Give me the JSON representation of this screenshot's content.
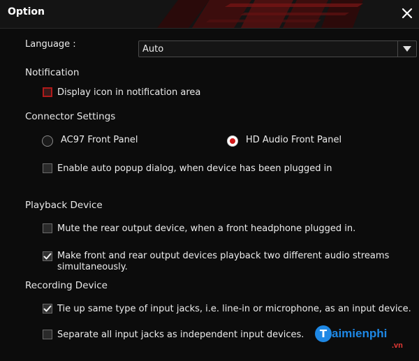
{
  "window": {
    "title": "Option"
  },
  "language": {
    "label": "Language :",
    "value": "Auto"
  },
  "notification": {
    "heading": "Notification",
    "display_icon_label": "Display icon in notification area",
    "display_icon_checked": false
  },
  "connector": {
    "heading": "Connector Settings",
    "ac97_label": "AC97 Front Panel",
    "hd_label": "HD Audio Front Panel",
    "selected": "HD Audio Front Panel",
    "auto_popup_label": "Enable auto popup dialog, when device has been plugged in",
    "auto_popup_checked": false
  },
  "playback": {
    "heading": "Playback Device",
    "mute_rear_label": "Mute the rear output device, when a front headphone plugged in.",
    "mute_rear_checked": false,
    "two_streams_line1": "Make front and rear output devices playback two different audio streams",
    "two_streams_line2": "simultaneously.",
    "two_streams_checked": true
  },
  "recording": {
    "heading": "Recording Device",
    "tie_up_label": "Tie up same type of input jacks, i.e. line-in or microphone, as an input device.",
    "tie_up_checked": true,
    "separate_label": "Separate all input jacks as independent input devices.",
    "separate_checked": false
  },
  "watermark": {
    "logo_letter": "T",
    "brand": "aimienphi",
    "tld": ".vn"
  },
  "colors": {
    "accent_red": "#d01818",
    "background": "#0c0c0c",
    "watermark_blue": "#1e88e5"
  },
  "icons": {
    "close": "close-icon",
    "dropdown": "chevron-down-icon",
    "check": "check-icon"
  }
}
